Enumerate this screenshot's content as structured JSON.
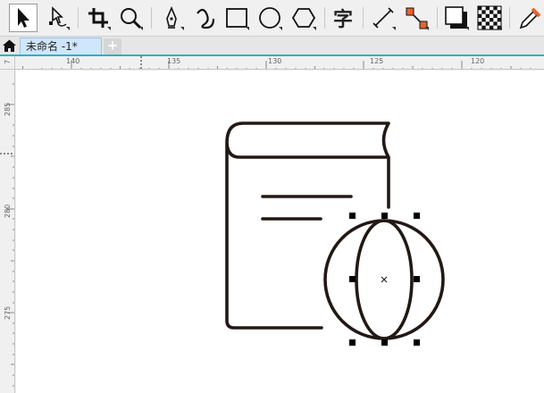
{
  "toolbar": {
    "tools": [
      {
        "name": "pick-tool-icon"
      },
      {
        "name": "shape-tool-icon"
      },
      {
        "name": "crop-tool-icon"
      },
      {
        "name": "zoom-tool-icon"
      },
      {
        "name": "pen-tool-icon"
      },
      {
        "name": "artistic-media-tool-icon"
      },
      {
        "name": "rectangle-tool-icon"
      },
      {
        "name": "ellipse-tool-icon"
      },
      {
        "name": "polygon-tool-icon"
      },
      {
        "name": "text-tool-icon",
        "glyph": "字"
      },
      {
        "name": "dimension-tool-icon"
      },
      {
        "name": "connector-tool-icon"
      },
      {
        "name": "drop-shadow-tool-icon"
      },
      {
        "name": "transparency-tool-icon"
      },
      {
        "name": "eyedropper-tool-icon"
      }
    ],
    "accent_color": "#e8622c"
  },
  "tabs": {
    "home_icon": "home-icon",
    "document_tab": "未命名 -1*",
    "new_tab": "+"
  },
  "rulers": {
    "horizontal": [
      "140",
      "135",
      "130",
      "125",
      "120"
    ],
    "horizontal_corner": "7",
    "vertical": [
      "285",
      "280",
      "275"
    ]
  },
  "colors": {
    "accent_line": "#18b5c6",
    "stroke": "#231815",
    "tab_active": "#cfe6fb"
  }
}
